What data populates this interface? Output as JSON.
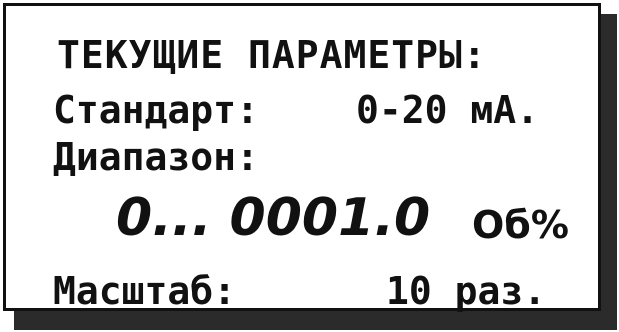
{
  "display": {
    "title": "ТЕКУЩИЕ ПАРАМЕТРЫ:",
    "standard": {
      "label": "Стандарт:",
      "value": "0-20 мА."
    },
    "range": {
      "label": "Диапазон:",
      "value": "0... 0001.0",
      "unit": "Об%"
    },
    "scale": {
      "label": "Масштаб:",
      "value": "10 раз."
    }
  }
}
